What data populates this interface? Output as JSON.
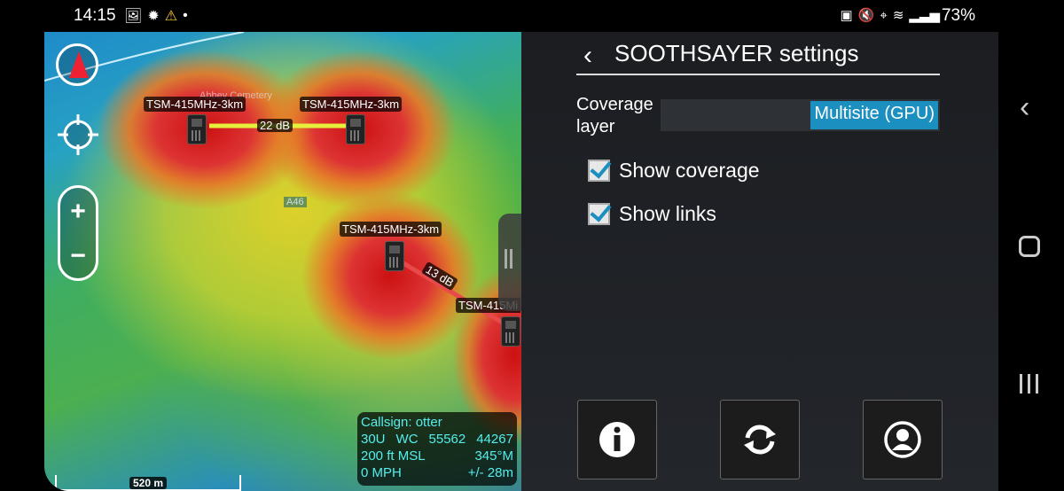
{
  "status": {
    "time": "14:15",
    "battery": "73%",
    "left_icons": [
      "image-icon",
      "settings-badge-icon",
      "warning-icon",
      "dot-icon"
    ],
    "right_icons": [
      "battery-saver-icon",
      "mute-icon",
      "location-icon",
      "wifi-icon",
      "signal-icon"
    ]
  },
  "map": {
    "sites": [
      {
        "label": "TSM-415MHz-3km"
      },
      {
        "label": "TSM-415MHz-3km"
      },
      {
        "label": "TSM-415MHz-3km"
      },
      {
        "label": "TSM-415Mi"
      }
    ],
    "links": [
      {
        "label": "22 dB",
        "color": "#e6ef3c"
      },
      {
        "label": "13 dB",
        "color": "#e84a4a"
      }
    ],
    "road_label": "A46",
    "cemetery_label": "Abbey Cemetery",
    "zoom_in": "+",
    "zoom_out": "−",
    "info": {
      "callsign": "Callsign: otter",
      "grid_zone": "30U",
      "grid_square": "WC",
      "easting": "55562",
      "northing": "44267",
      "altitude": "200 ft MSL",
      "heading": "345°M",
      "speed": "0 MPH",
      "accuracy": "+/- 28m"
    },
    "scale": "520 m"
  },
  "settings": {
    "title": "SOOTHSAYER settings",
    "coverage_layer_label": "Coverage layer",
    "coverage_layer_value": "Multisite (GPU)",
    "show_coverage_label": "Show coverage",
    "show_coverage_checked": true,
    "show_links_label": "Show links",
    "show_links_checked": true,
    "accent": "#1a8fc0",
    "buttons": [
      "info-icon",
      "refresh-icon",
      "account-icon"
    ]
  }
}
